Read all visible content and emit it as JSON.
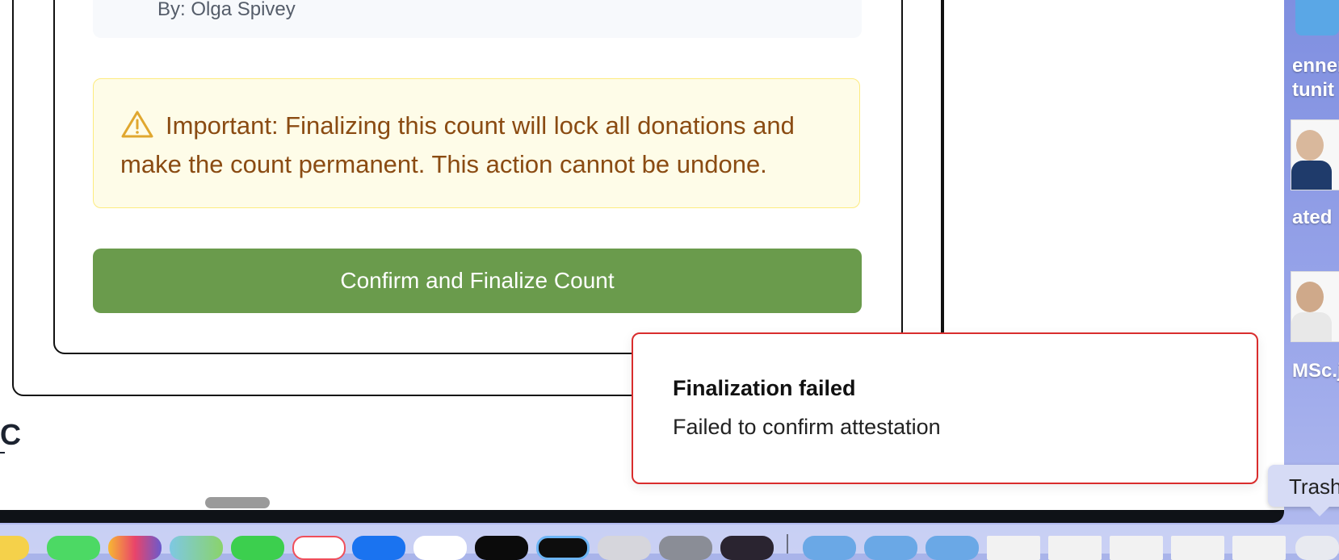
{
  "attestation": {
    "by_text": "By: Olga Spivey"
  },
  "warning": {
    "text": "Important: Finalizing this count will lock all donations and make the count permanent. This action cannot be undone."
  },
  "actions": {
    "confirm_label": "Confirm and Finalize Count"
  },
  "brand": {
    "text": "C"
  },
  "toast": {
    "title": "Finalization failed",
    "message": "Failed to confirm attestation"
  },
  "desktop": {
    "items": [
      "enner",
      "tunit",
      "ated",
      "MSc.j"
    ],
    "trash_tooltip": "Trash"
  },
  "dock": {
    "icons": [
      "notes-icon",
      "messages-icon",
      "photos-icon",
      "maps-icon",
      "facetime-icon",
      "news-icon",
      "app-store-icon",
      "chatgpt-icon",
      "capcut-icon",
      "preview-icon",
      "iphone-mirroring-icon",
      "settings-icon",
      "audio-app-icon",
      "folder-icon",
      "folder-icon",
      "folder-icon",
      "document-thumb-icon",
      "document-thumb-icon",
      "document-thumb-icon",
      "document-thumb-icon",
      "document-thumb-icon",
      "document-thumb-icon",
      "trash-icon"
    ]
  },
  "colors": {
    "confirm": "#6a9b4c",
    "warning_bg": "#fefce8",
    "warning_text": "#8a4b12",
    "toast_border": "#d92d2d"
  }
}
